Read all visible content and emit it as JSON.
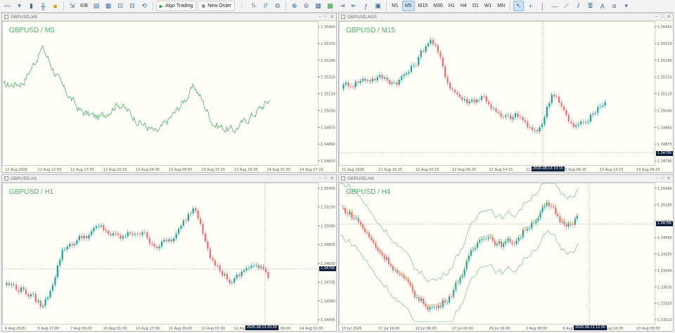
{
  "toolbar": {
    "ide_label": "IDE",
    "algo_label": "Algo Trading",
    "neworder_label": "New Order",
    "timeframes": [
      "M1",
      "M5",
      "M15",
      "M30",
      "H1",
      "H4",
      "D1",
      "W1",
      "MN"
    ],
    "active_timeframe": "M5"
  },
  "charts": [
    {
      "title": "GBPUSD,M5",
      "label": "GBPUSD / M5",
      "type": "line",
      "color": "#4caf67",
      "prices": [
        "1.35450",
        "1.35370",
        "1.35290",
        "1.35210",
        "1.35130",
        "1.35050",
        "1.34970",
        "1.34890",
        "1.34810"
      ],
      "times": [
        "12 Aug 2026",
        "12 Aug 12:55",
        "12 Aug 17:55",
        "12 Aug 22:15",
        "13 Aug 04:35",
        "13 Aug 09:55",
        "13 Aug 15:15",
        "13 Aug 20:35",
        "14 Aug 01:55",
        "14 Aug 07:15"
      ]
    },
    {
      "title": "GBPUSD,M15",
      "label": "GBPUSD / M15",
      "type": "candles",
      "prices": [
        "1.35450",
        "1.35370",
        "1.35290",
        "1.35210",
        "1.35125",
        "1.35040",
        "1.34960",
        "1.34875",
        "1.34795"
      ],
      "times": [
        "11 Aug 2026",
        "11 Aug 16:15",
        "12 Aug 02:15",
        "12 Aug 06:15",
        "12 Aug 14:15",
        "12 Aug 22:15",
        "13 Aug 06:15",
        "13 Aug 14:15",
        "14 Aug 06:15"
      ],
      "last_price": "1.34795",
      "crosshair_time": "2026.08.13 19:15"
    },
    {
      "title": "GBPUSD,H1",
      "label": "GBPUSD / H1",
      "type": "candles",
      "prices": [
        "1.35455",
        "1.35230",
        "1.35080",
        "1.34955",
        "1.34830",
        "1.34705",
        "1.34580",
        "1.34455"
      ],
      "times": [
        "6 Aug 2026",
        "6 Aug 17:00",
        "7 Aug 09:00",
        "10 Aug 01:00",
        "10 Aug 17:00",
        "11 Aug 09:00",
        "12 Aug 01:00",
        "12 Aug 17:00",
        "13 Aug 09:00",
        "14 Aug 01:00"
      ],
      "last_price": "1.34755",
      "crosshair_time": "2026.08.13 20:00"
    },
    {
      "title": "GBPUSD,H4",
      "label": "GBPUSD / H4",
      "type": "candles-bb",
      "prices": [
        "1.35490",
        "1.35180",
        "1.34870",
        "1.34560",
        "1.34250",
        "1.33940",
        "1.33630",
        "1.33320",
        "1.33010"
      ],
      "times": [
        "15 Jul 2026",
        "17 Jul 16:00",
        "22 Jul 08:00",
        "27 Jul 00:00",
        "29 Jul 16:00",
        "3 Aug 08:00",
        "6 Aug 00:00",
        "10 Aug 16:00",
        "13 Aug 08:00"
      ],
      "last_price": "1.34795",
      "crosshair_time": "2026.08.13 12:00"
    }
  ]
}
